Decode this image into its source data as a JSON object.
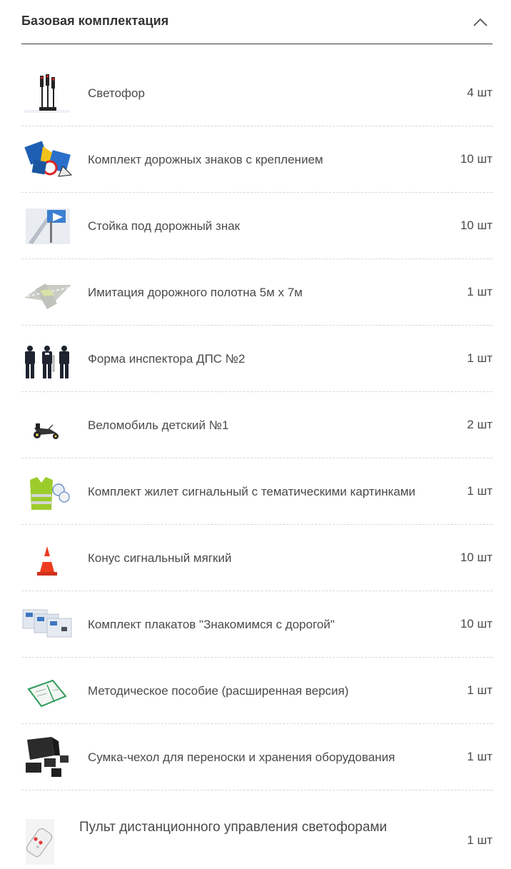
{
  "section": {
    "title": "Базовая комплектация",
    "collapse_icon": "chevron-up-icon"
  },
  "items": [
    {
      "name": "Светофор",
      "qty": "4 шт",
      "icon": "traffic-light-icon"
    },
    {
      "name": "Комплект дорожных знаков с креплением",
      "qty": "10 шт",
      "icon": "road-signs-icon"
    },
    {
      "name": "Стойка под дорожный знак",
      "qty": "10 шт",
      "icon": "sign-stand-icon"
    },
    {
      "name": "Имитация дорожного полотна 5м х 7м",
      "qty": "1 шт",
      "icon": "road-mat-icon"
    },
    {
      "name": "Форма инспектора ДПС №2",
      "qty": "1 шт",
      "icon": "police-uniform-icon"
    },
    {
      "name": "Веломобиль детский №1",
      "qty": "2 шт",
      "icon": "pedal-car-icon"
    },
    {
      "name": "Комплект жилет сигнальный с тематическими картинками",
      "qty": "1 шт",
      "icon": "safety-vest-icon"
    },
    {
      "name": "Конус сигнальный мягкий",
      "qty": "10 шт",
      "icon": "traffic-cone-icon"
    },
    {
      "name": "Комплект плакатов \"Знакомимся с дорогой\"",
      "qty": "10 шт",
      "icon": "posters-icon"
    },
    {
      "name": "Методическое пособие (расширенная версия)",
      "qty": "1 шт",
      "icon": "book-icon"
    },
    {
      "name": "Сумка-чехол для переноски и хранения оборудования",
      "qty": "1 шт",
      "icon": "carry-bag-icon"
    },
    {
      "name": "Пульт дистанционного управления светофорами",
      "qty": "1 шт",
      "icon": "remote-control-icon"
    }
  ]
}
